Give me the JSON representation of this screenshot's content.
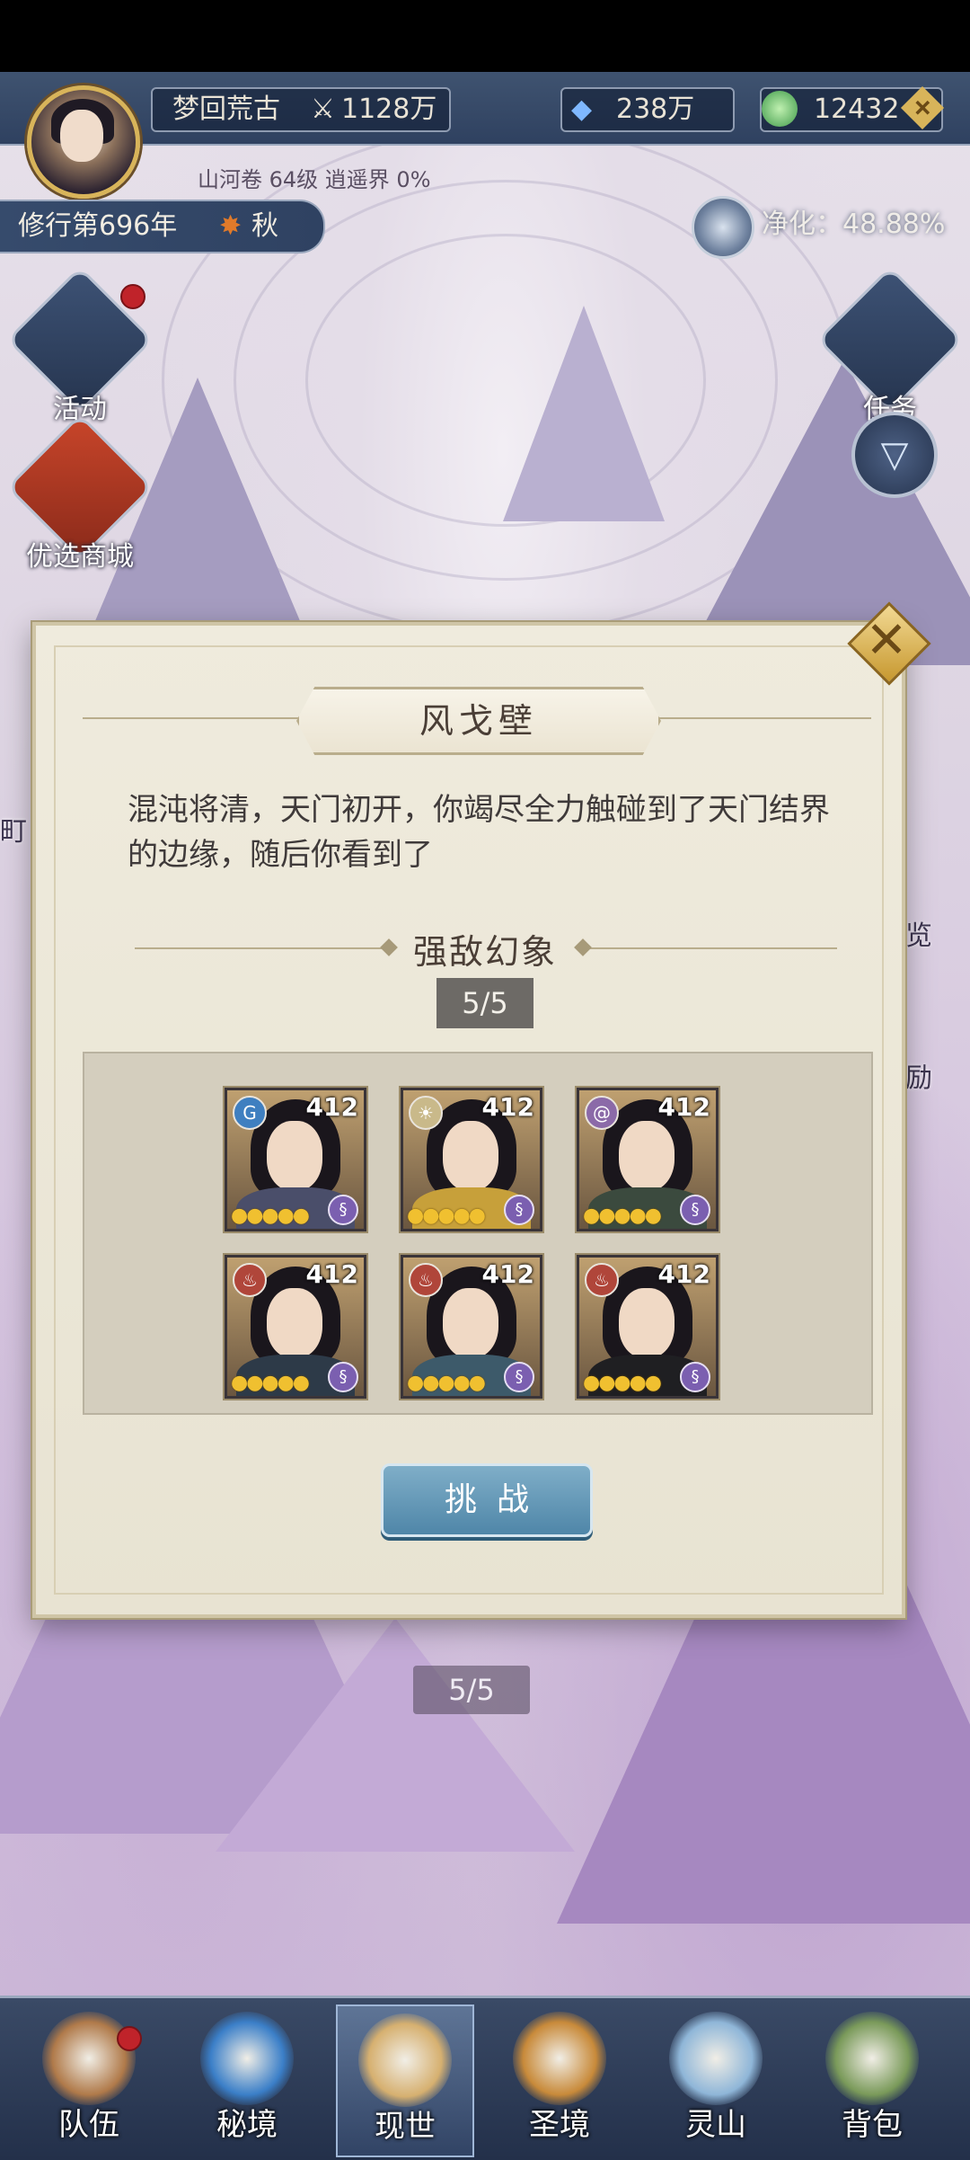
{
  "hud": {
    "realm_name": "梦回荒古",
    "power": "1128万",
    "spirit_stones": "238万",
    "jade": "12432",
    "sub_info": "山河卷 64级 逍遥界 0%",
    "cultivation_year": "修行第696年",
    "season": "秋",
    "purify": "净化：48.88%"
  },
  "side_menu": {
    "activity": "活动",
    "shop": "优选商城",
    "tasks": "任务"
  },
  "map": {
    "partial_label_1": "览",
    "partial_label_2": "励",
    "partial_label_3": "町",
    "background_counter": "5/5"
  },
  "modal": {
    "title": "风戈壁",
    "description": "混沌将清，天门初开，你竭尽全力触碰到了天门结界的边缘，随后你看到了",
    "section_title": "强敌幻象",
    "progress": "5/5",
    "challenge_button": "挑战",
    "enemies": [
      {
        "level": "412",
        "element": "G",
        "element_color": "#3f7fc0",
        "stars": 5,
        "robe": "#4a4e6a"
      },
      {
        "level": "412",
        "element": "☀",
        "element_color": "#c9b98a",
        "stars": 5,
        "robe": "#c7a03a"
      },
      {
        "level": "412",
        "element": "@",
        "element_color": "#8b6aa8",
        "stars": 5,
        "robe": "#3b4a3e"
      },
      {
        "level": "412",
        "element": "♨",
        "element_color": "#b0463a",
        "stars": 5,
        "robe": "#2d3a48"
      },
      {
        "level": "412",
        "element": "♨",
        "element_color": "#b0463a",
        "stars": 5,
        "robe": "#3d5a6a"
      },
      {
        "level": "412",
        "element": "♨",
        "element_color": "#b0463a",
        "stars": 5,
        "robe": "#1f1f22"
      }
    ]
  },
  "bottom_nav": [
    {
      "label": "队伍",
      "color": "#b07a4a"
    },
    {
      "label": "秘境",
      "color": "#3b7fc8"
    },
    {
      "label": "现世",
      "color": "#d6b070"
    },
    {
      "label": "圣境",
      "color": "#c88a3a"
    },
    {
      "label": "灵山",
      "color": "#8fb6d8"
    },
    {
      "label": "背包",
      "color": "#7a9a5a"
    }
  ]
}
